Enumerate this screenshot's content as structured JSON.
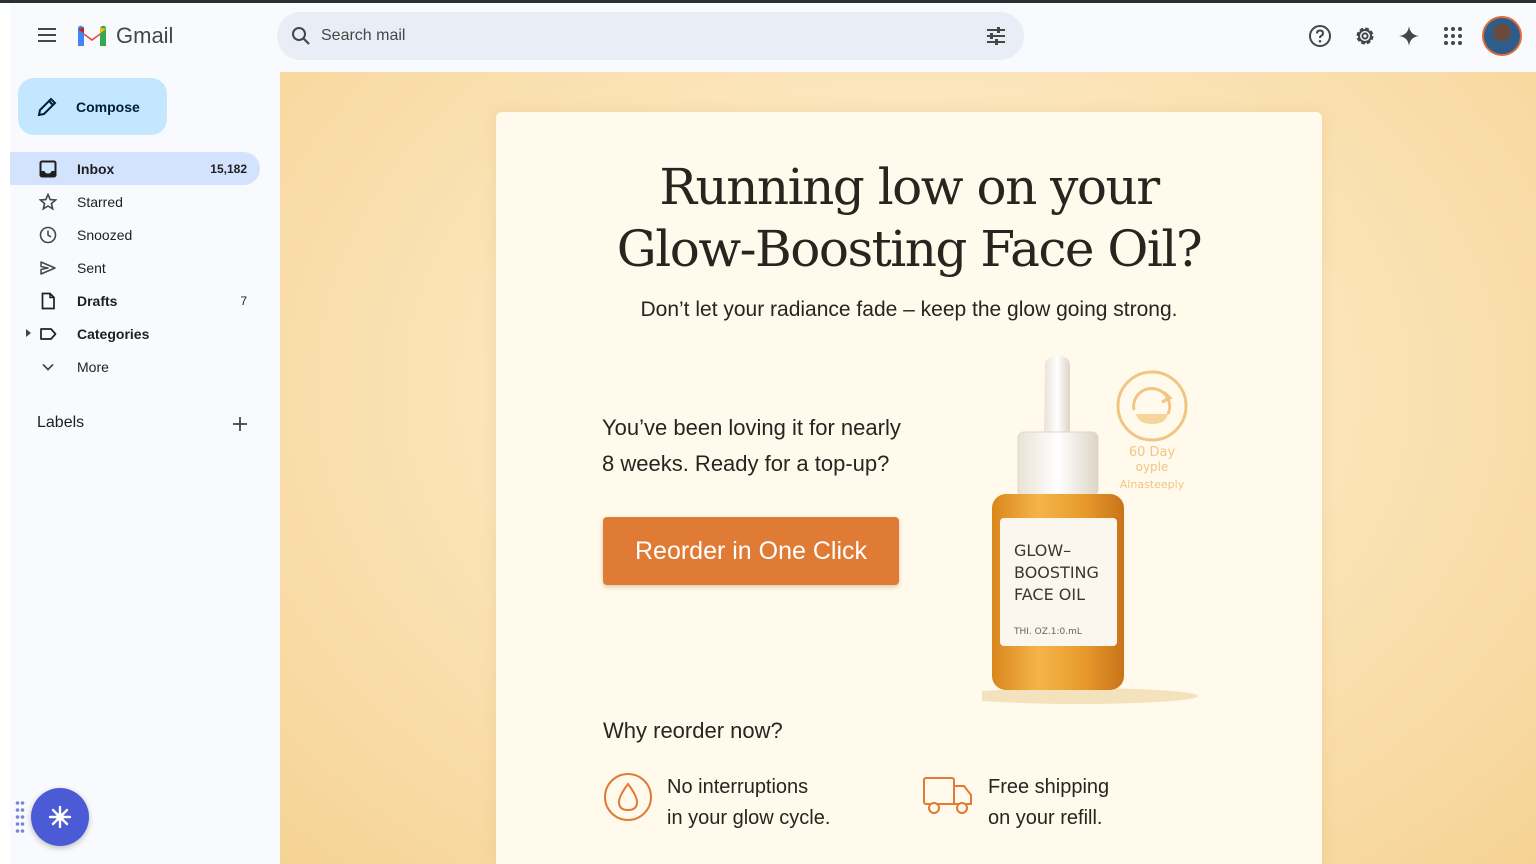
{
  "app": {
    "name": "Gmail"
  },
  "search": {
    "placeholder": "Search mail"
  },
  "compose": {
    "label": "Compose"
  },
  "sidebar": {
    "items": [
      {
        "label": "Inbox",
        "count": "15,182"
      },
      {
        "label": "Starred",
        "count": ""
      },
      {
        "label": "Snoozed",
        "count": ""
      },
      {
        "label": "Sent",
        "count": ""
      },
      {
        "label": "Drafts",
        "count": "7"
      },
      {
        "label": "Categories",
        "count": ""
      },
      {
        "label": "More",
        "count": ""
      }
    ],
    "labels_heading": "Labels"
  },
  "email": {
    "headline_line1": "Running low on your",
    "headline_line2": "Glow-Boosting Face Oil?",
    "subline": "Don’t let your radiance fade – keep the glow going strong.",
    "loving_line1": "You’ve been loving it for nearly",
    "loving_line2": "8 weeks. Ready for a top-up?",
    "cta": "Reorder in One Click",
    "why_heading": "Why reorder now?",
    "benefits": [
      {
        "line1": "No interruptions",
        "line2": "in your glow cycle.",
        "icon": "drop-icon"
      },
      {
        "line1": "Free shipping",
        "line2": "on your refill.",
        "icon": "truck-icon"
      }
    ],
    "bottle_label_line1": "GLOW–",
    "bottle_label_line2": "BOOSTING",
    "bottle_label_line3": "FACE OIL",
    "bottle_label_small": "THI. OZ.1:0.mL",
    "badge_line1": "60 Day",
    "badge_line2": "oyple",
    "badge_line3": "Alnasteeply"
  },
  "colors": {
    "accent": "#e07b35",
    "compose_bg": "#c2e7ff",
    "active_nav": "#d3e3fd",
    "fab": "#4b5bd6"
  }
}
